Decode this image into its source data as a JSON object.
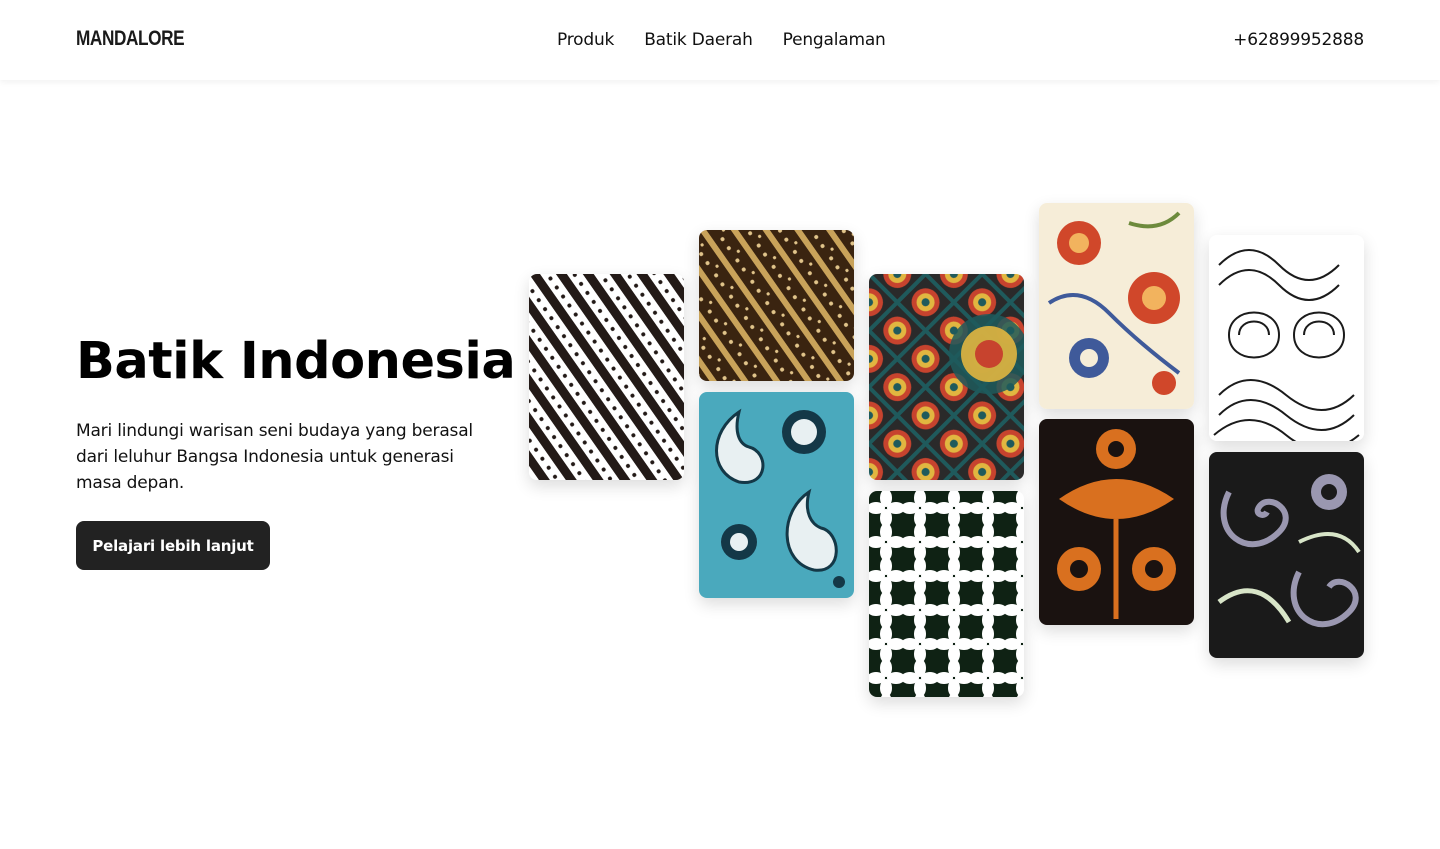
{
  "nav": {
    "brand": "MANDALORE",
    "links": [
      "Produk",
      "Batik Daerah",
      "Pengalaman"
    ],
    "phone": "+62899952888"
  },
  "hero": {
    "title": "Batik Indonesia",
    "description": "Mari lindungi warisan seni budaya yang berasal dari leluhur Bangsa Indonesia untuk generasi masa depan.",
    "cta_label": "Pelajari lebih lanjut"
  },
  "gallery": {
    "tiles": [
      {
        "name": "parang-black-white",
        "colors": [
          "#ffffff",
          "#231a17"
        ]
      },
      {
        "name": "parang-brown-gold",
        "colors": [
          "#3a2410",
          "#c9a35a"
        ]
      },
      {
        "name": "paisley-teal",
        "colors": [
          "#4aa9bd",
          "#e8f0f2",
          "#143847"
        ]
      },
      {
        "name": "mosaic-medallion",
        "colors": [
          "#1f5a5c",
          "#c7432e",
          "#e1b640",
          "#2a2a2a"
        ]
      },
      {
        "name": "kawung-green-white",
        "colors": [
          "#ffffff",
          "#0f2214"
        ]
      },
      {
        "name": "floral-cream",
        "colors": [
          "#f6edd8",
          "#d0472a",
          "#3f5a9a"
        ]
      },
      {
        "name": "floral-orange-black",
        "colors": [
          "#1a1210",
          "#d9701f"
        ]
      },
      {
        "name": "swirl-line-art",
        "colors": [
          "#ffffff",
          "#1b1b1b"
        ]
      },
      {
        "name": "paisley-grey-black",
        "colors": [
          "#1a1a1a",
          "#9a97b0",
          "#d8e5c8"
        ]
      }
    ]
  }
}
